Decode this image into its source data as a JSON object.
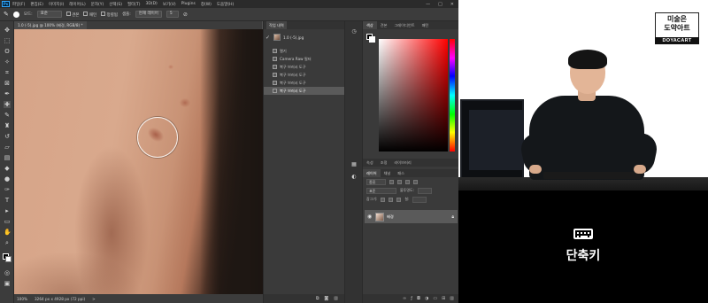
{
  "menubar": {
    "app_icon": "Ps",
    "items": [
      "파일(F)",
      "편집(E)",
      "이미지(I)",
      "레이어(L)",
      "문자(Y)",
      "선택(S)",
      "필터(T)",
      "3D(D)",
      "보기(V)",
      "Plugins",
      "창(W)",
      "도움말(H)"
    ],
    "window_controls": [
      "—",
      "□",
      "✕"
    ]
  },
  "options": {
    "mode_label": "모드:",
    "mode_value": "표준",
    "source_a": "견본",
    "source_b": "패턴",
    "align_label": "정렬됨",
    "sample_label": "샘플:",
    "sample_value": "현재 레이어",
    "diffusion": "5"
  },
  "document": {
    "tab_title": "1.0 (-5).jpg @ 100% (배경, RGB/8) *"
  },
  "status": {
    "zoom": "100%",
    "doc_size": "3264 px x 4928 px (72 ppi)",
    "arrow": ">"
  },
  "history": {
    "title": "작업 내역",
    "snapshot_name": "1.0 (-5).jpg",
    "steps": [
      {
        "label": "열기",
        "active": false
      },
      {
        "label": "Camera Raw 필터",
        "active": false
      },
      {
        "label": "복구 브러시 도구",
        "active": false
      },
      {
        "label": "복구 브러시 도구",
        "active": false
      },
      {
        "label": "복구 브러시 도구",
        "active": false
      },
      {
        "label": "복구 브러시 도구",
        "active": true
      }
    ]
  },
  "color_panel": {
    "tabs": [
      "색상",
      "견본",
      "그레이디언트",
      "패턴"
    ],
    "active_tab": 0
  },
  "layers_panel": {
    "top_tabs": [
      "속성",
      "조정",
      "라이브러리"
    ],
    "tabs": [
      "레이어",
      "채널",
      "패스"
    ],
    "kind_label": "종류",
    "blend_mode": "표준",
    "opacity_label": "불투명도:",
    "lock_label": "잠그기:",
    "fill_label": "칠:",
    "layer_name": "배경"
  },
  "brand": {
    "line1": "미술은",
    "line2": "도약아트",
    "line3": "DOYACART"
  },
  "caption": {
    "text": "단축키"
  }
}
